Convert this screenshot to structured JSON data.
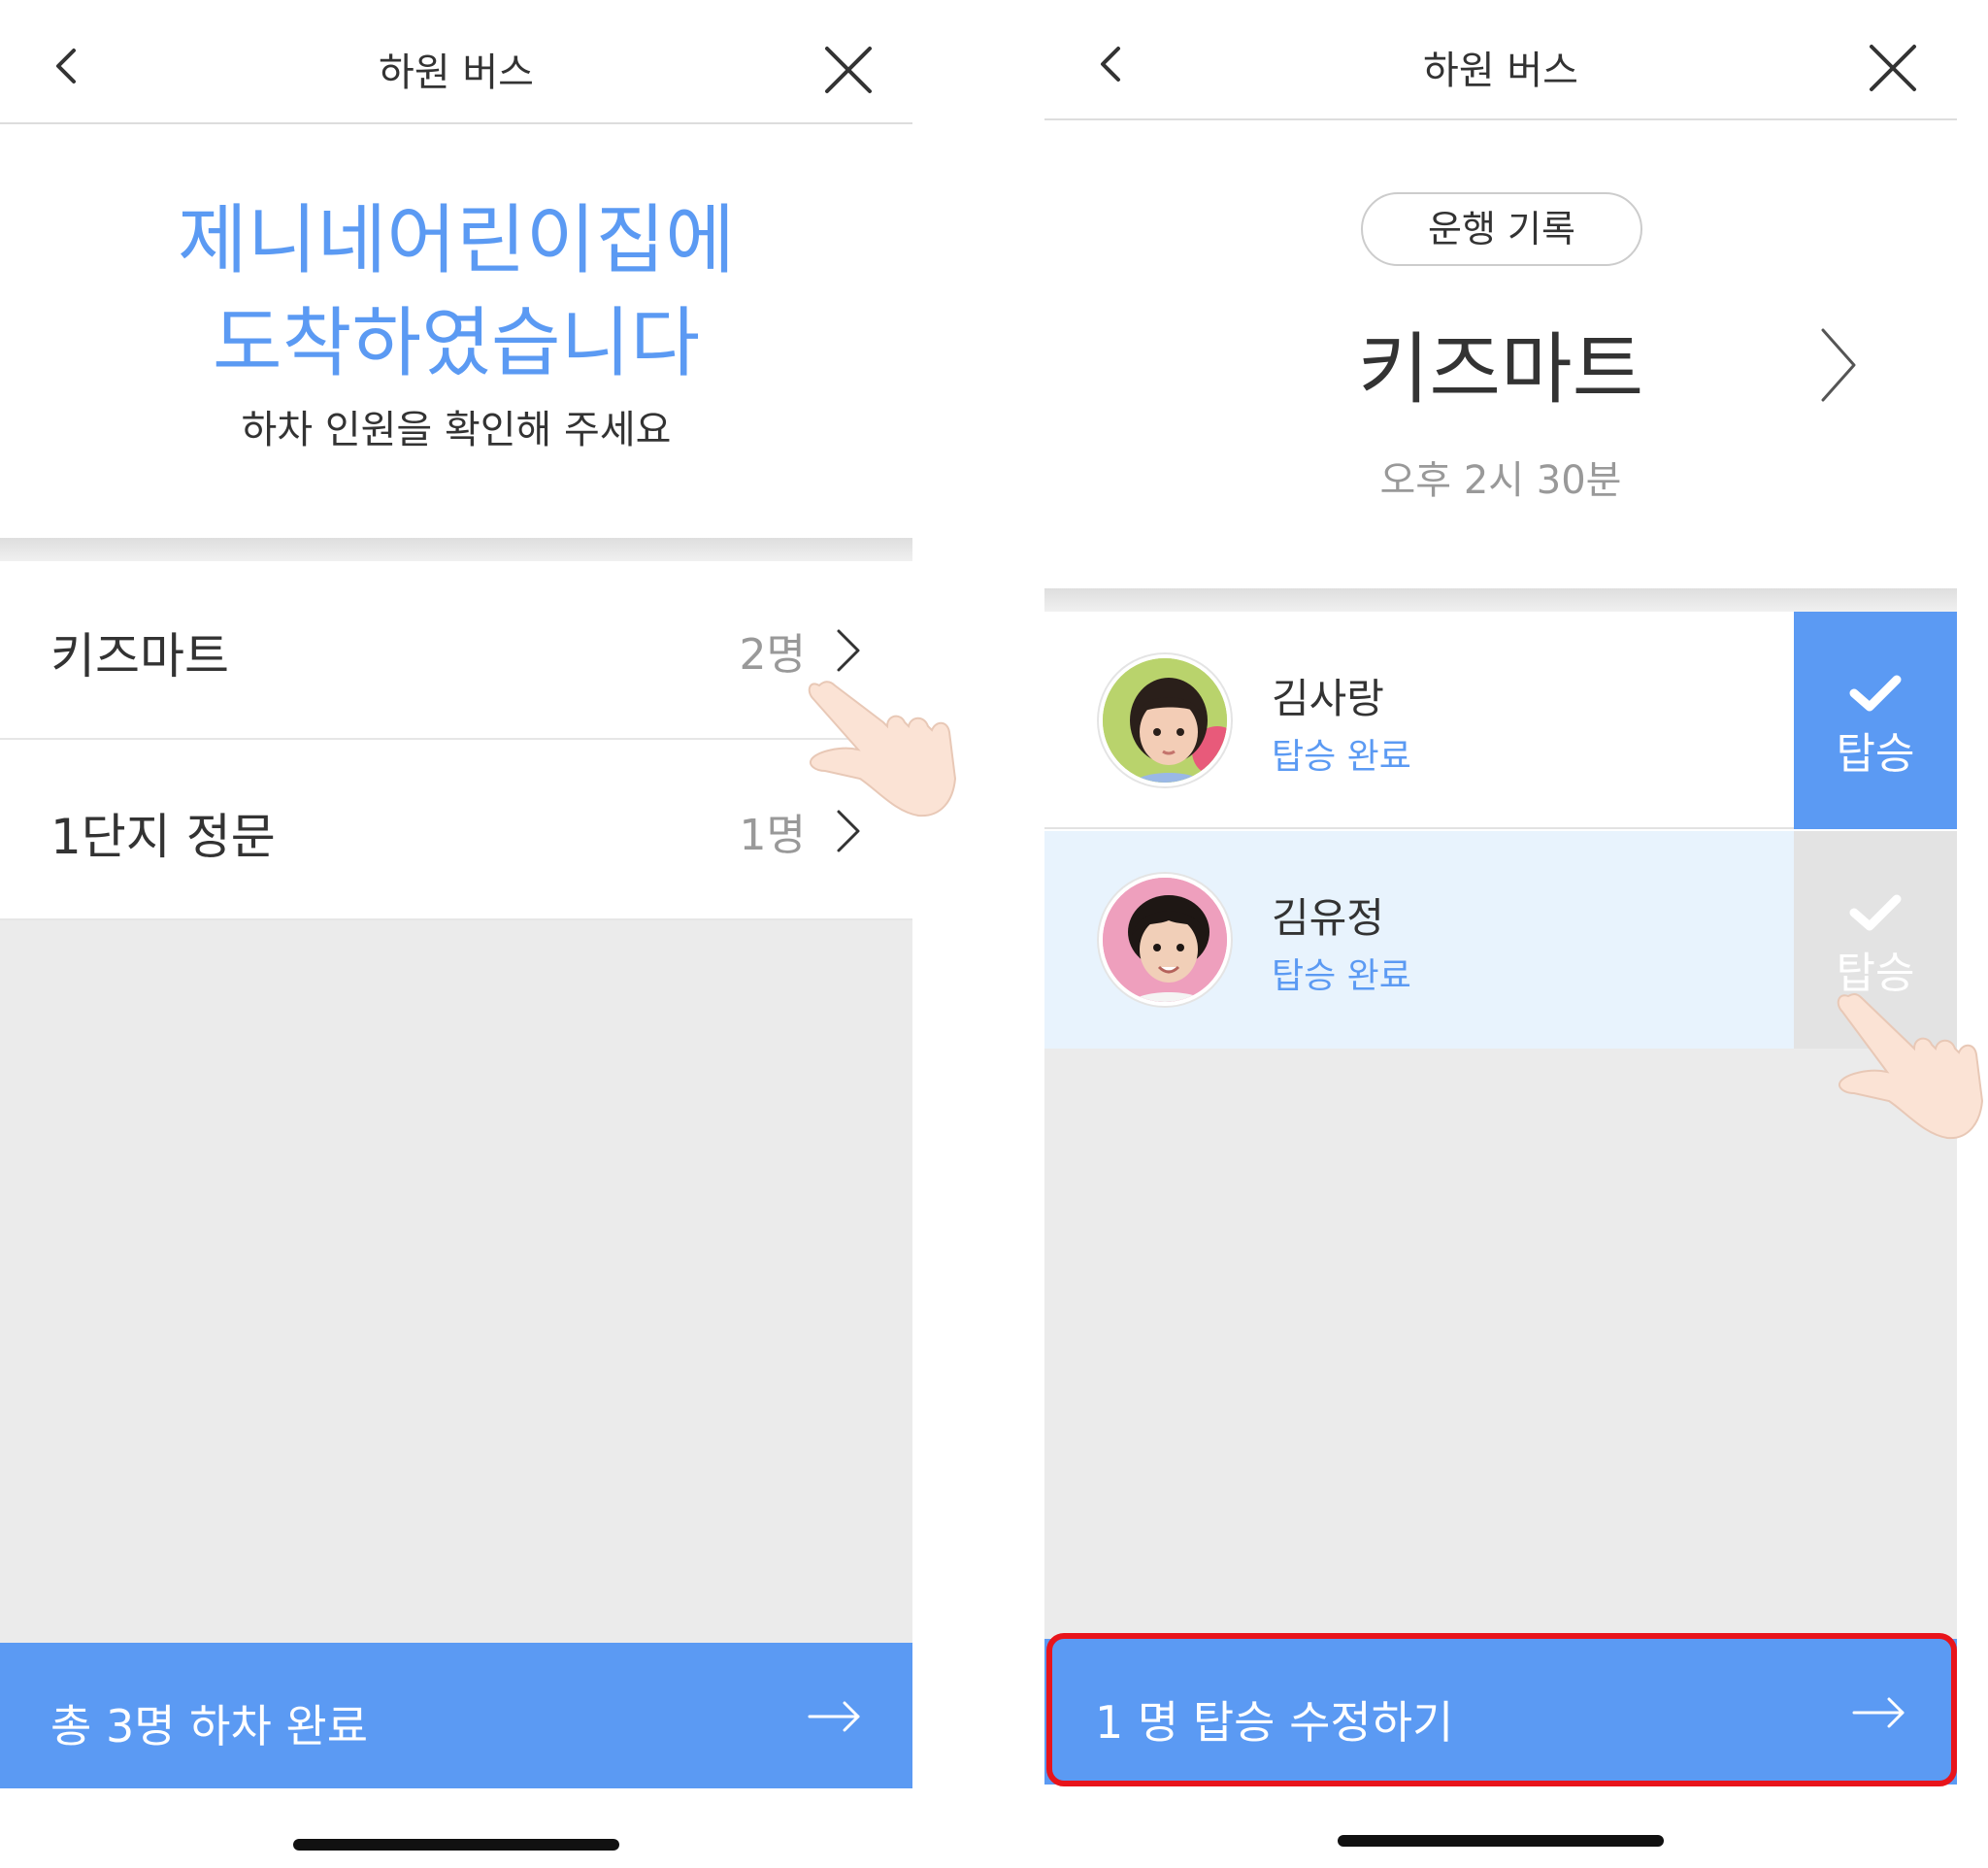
{
  "left_screen": {
    "header": {
      "title": "하원 버스",
      "back_icon": "chevron-left-icon",
      "close_icon": "close-icon"
    },
    "hero": {
      "line1": "제니네어린이집에",
      "line2": "도착하였습니다",
      "subtitle": "하차 인원을 확인해 주세요"
    },
    "stops": [
      {
        "name": "키즈마트",
        "count": "2명"
      },
      {
        "name": "1단지 정문",
        "count": "1명"
      }
    ],
    "bottom_button": {
      "label": "총 3명 하차 완료",
      "icon": "arrow-right-icon"
    }
  },
  "right_screen": {
    "header": {
      "title": "하원 버스",
      "back_icon": "chevron-left-icon",
      "close_icon": "close-icon"
    },
    "record_button": "운행 기록",
    "stop": {
      "name": "키즈마트",
      "time": "오후 2시 30분"
    },
    "children": [
      {
        "name": "김사랑",
        "status": "탑승 완료",
        "board_label": "탑승",
        "boarded": true
      },
      {
        "name": "김유정",
        "status": "탑승 완료",
        "board_label": "탑승",
        "boarded": false
      }
    ],
    "bottom_button": {
      "label": "1 명 탑승 수정하기",
      "icon": "arrow-right-icon"
    }
  },
  "colors": {
    "accent": "#5b9af3",
    "highlight": "#e8141b",
    "gray_background": "#ebebeb",
    "selected_row": "#e8f3fd"
  }
}
